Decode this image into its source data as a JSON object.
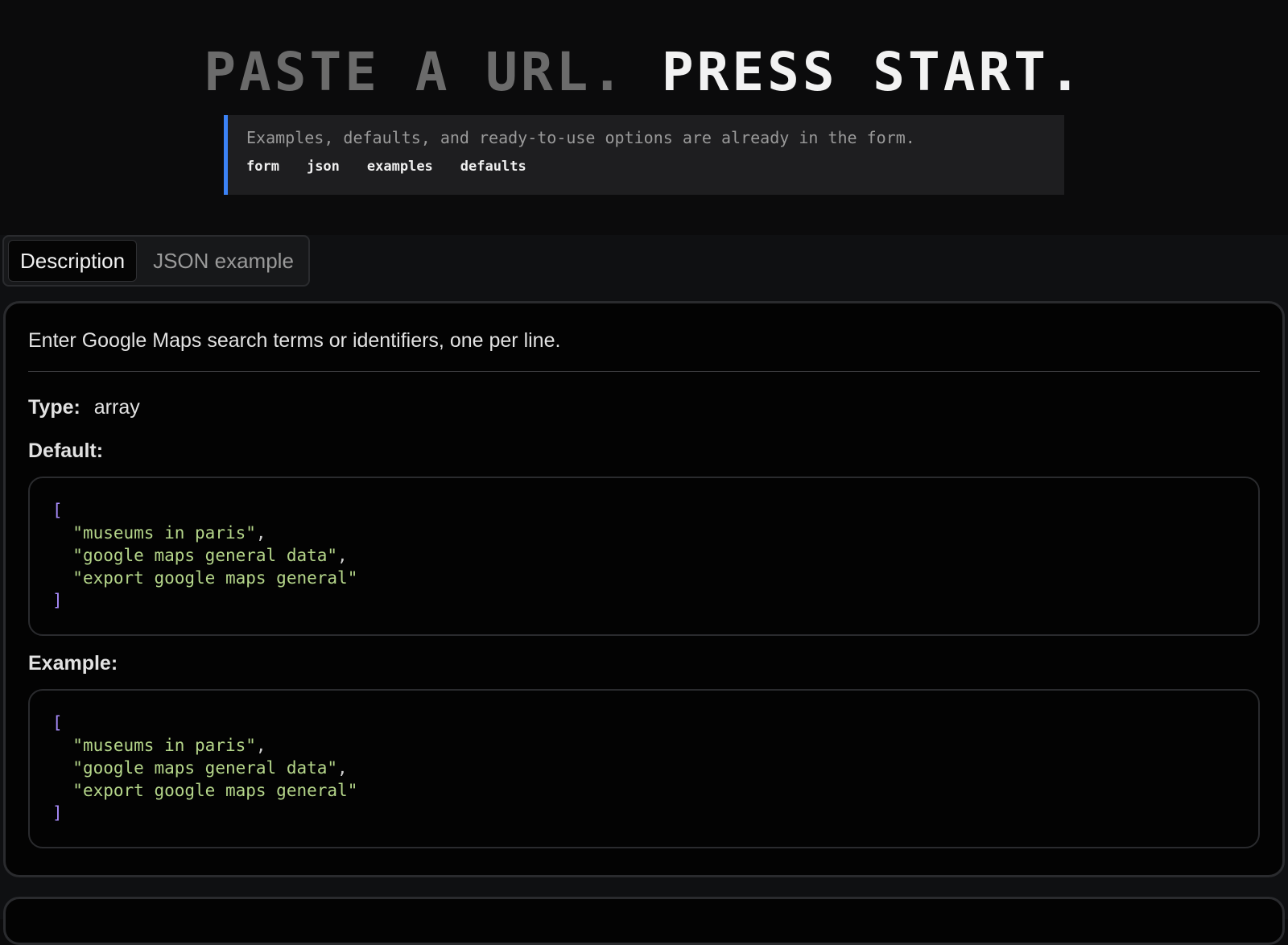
{
  "hero": {
    "title_dim": "PASTE A URL.",
    "title_bright": "PRESS START."
  },
  "hint": {
    "text": "Examples, defaults, and ready-to-use options are already in the form.",
    "chips": [
      "form",
      "json",
      "examples",
      "defaults"
    ]
  },
  "tabs": [
    {
      "label": "Description",
      "active": true
    },
    {
      "label": "JSON example",
      "active": false
    }
  ],
  "panel": {
    "description": "Enter Google Maps search terms or identifiers, one per line.",
    "type_label": "Type:",
    "type_value": "array",
    "default_label": "Default:",
    "example_label": "Example:",
    "default_items": [
      "museums in paris",
      "google maps general data",
      "export google maps general"
    ],
    "example_items": [
      "museums in paris",
      "google maps general data",
      "export google maps general"
    ]
  },
  "colors": {
    "accent": "#3b82f6",
    "bracket": "#a78bfa",
    "string": "#b5d68a"
  }
}
